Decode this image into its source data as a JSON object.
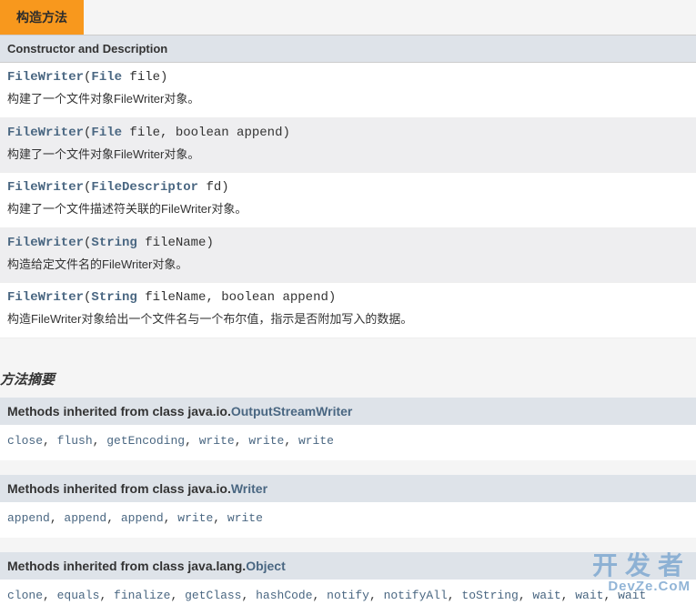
{
  "tab_label": "构造方法",
  "constructor_header": "Constructor and Description",
  "constructors": [
    {
      "class_name": "FileWriter",
      "params": [
        {
          "type_link": "File",
          "name": "file"
        }
      ],
      "extra_params": "",
      "desc": "构建了一个文件对象FileWriter对象。"
    },
    {
      "class_name": "FileWriter",
      "params": [
        {
          "type_link": "File",
          "name": "file"
        }
      ],
      "extra_params": ", boolean append",
      "desc": "构建了一个文件对象FileWriter对象。"
    },
    {
      "class_name": "FileWriter",
      "params": [
        {
          "type_link": "FileDescriptor",
          "name": "fd"
        }
      ],
      "extra_params": "",
      "desc": "构建了一个文件描述符关联的FileWriter对象。"
    },
    {
      "class_name": "FileWriter",
      "params": [
        {
          "type_link": "String",
          "name": "fileName"
        }
      ],
      "extra_params": "",
      "desc": "构造给定文件名的FileWriter对象。"
    },
    {
      "class_name": "FileWriter",
      "params": [
        {
          "type_link": "String",
          "name": "fileName"
        }
      ],
      "extra_params": ", boolean append",
      "desc": "构造FileWriter对象给出一个文件名与一个布尔值，指示是否附加写入的数据。"
    }
  ],
  "methods_summary_title": "方法摘要",
  "inherited": [
    {
      "prefix": "Methods inherited from class java.io.",
      "cls": "OutputStreamWriter",
      "methods": [
        "close",
        "flush",
        "getEncoding",
        "write",
        "write",
        "write"
      ]
    },
    {
      "prefix": "Methods inherited from class java.io.",
      "cls": "Writer",
      "methods": [
        "append",
        "append",
        "append",
        "write",
        "write"
      ]
    },
    {
      "prefix": "Methods inherited from class java.lang.",
      "cls": "Object",
      "methods": [
        "clone",
        "equals",
        "finalize",
        "getClass",
        "hashCode",
        "notify",
        "notifyAll",
        "toString",
        "wait",
        "wait",
        "wait"
      ]
    }
  ],
  "watermark_main": "开发者",
  "watermark_sub": "DevZe.CoM"
}
